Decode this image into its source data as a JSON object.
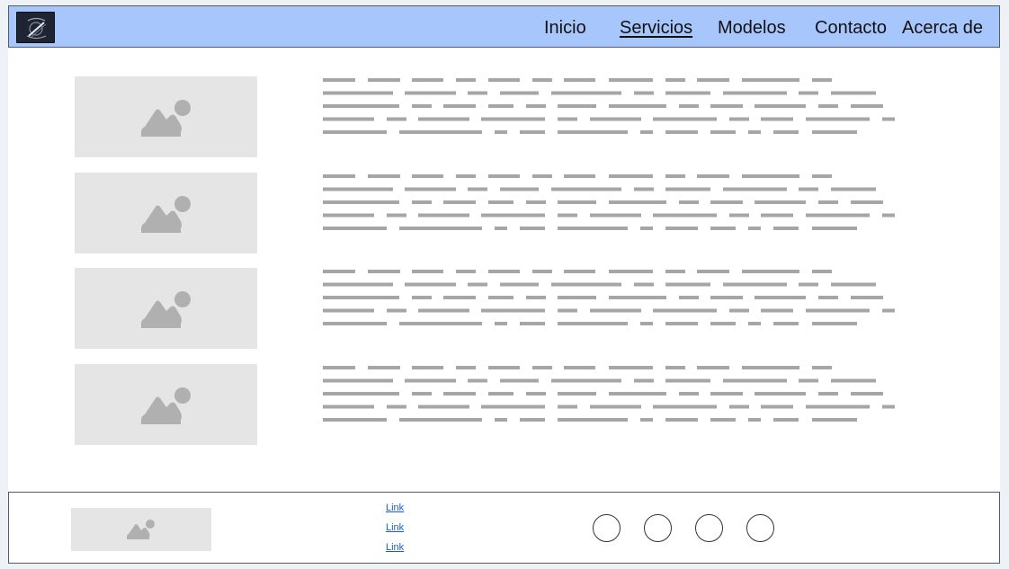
{
  "header": {
    "logo_icon": "logo-icon",
    "nav": [
      {
        "label": "Inicio",
        "active": false
      },
      {
        "label": "Servicios",
        "active": true
      },
      {
        "label": "Modelos",
        "active": false
      },
      {
        "label": "Contacto",
        "active": false
      },
      {
        "label": "Acerca de",
        "active": false
      }
    ]
  },
  "main": {
    "rows": [
      {
        "image_icon": "image-placeholder-icon",
        "text_icon": "placeholder-text-lines"
      },
      {
        "image_icon": "image-placeholder-icon",
        "text_icon": "placeholder-text-lines"
      },
      {
        "image_icon": "image-placeholder-icon",
        "text_icon": "placeholder-text-lines"
      },
      {
        "image_icon": "image-placeholder-icon",
        "text_icon": "placeholder-text-lines"
      }
    ]
  },
  "footer": {
    "image_icon": "image-placeholder-icon",
    "links": [
      "Link",
      "Link",
      "Link"
    ],
    "social_icons": [
      "circle-icon",
      "circle-icon",
      "circle-icon",
      "circle-icon"
    ]
  },
  "colors": {
    "header_bg": "#a7c7fc",
    "placeholder_bg": "#e5e5e5",
    "placeholder_icon": "#b0b0b0",
    "text_line": "#a6a6a6",
    "link": "#1a5fc9"
  }
}
